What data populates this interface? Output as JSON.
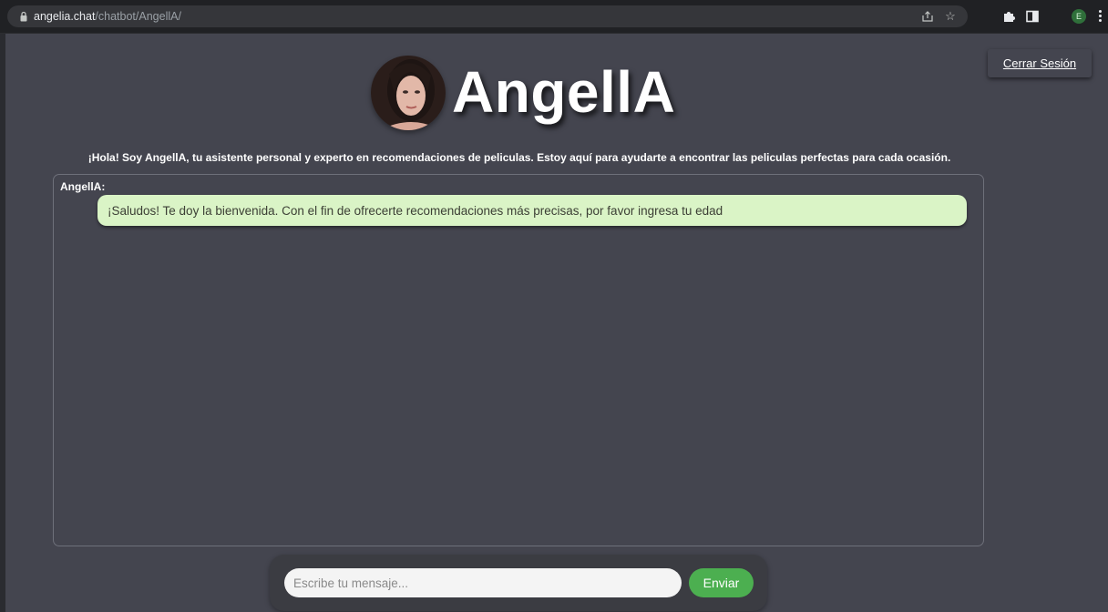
{
  "browser": {
    "url_host": "angelia.chat",
    "url_path": "/chatbot/AngellA/",
    "profile_initial": "E"
  },
  "header": {
    "logout_label": "Cerrar Sesión",
    "title": "AngellA",
    "intro": "¡Hola! Soy AngellA, tu asistente personal y experto en recomendaciones de peliculas. Estoy aquí para ayudarte a encontrar las peliculas perfectas para cada ocasión."
  },
  "chat": {
    "messages": [
      {
        "sender": "AngellA:",
        "text": "¡Saludos! Te doy la bienvenida. Con el fin de ofrecerte recomendaciones más precisas, por favor ingresa tu edad"
      }
    ]
  },
  "composer": {
    "placeholder": "Escribe tu mensaje...",
    "value": "",
    "send_label": "Enviar"
  },
  "colors": {
    "page_bg": "#44454f",
    "bubble_bg": "#daf4c6",
    "send_button": "#4caf50",
    "browser_bar": "#202124"
  },
  "icons": [
    "lock-icon",
    "share-icon",
    "star-icon",
    "extensions-icon",
    "side-panel-icon",
    "profile-avatar",
    "menu-icon"
  ]
}
